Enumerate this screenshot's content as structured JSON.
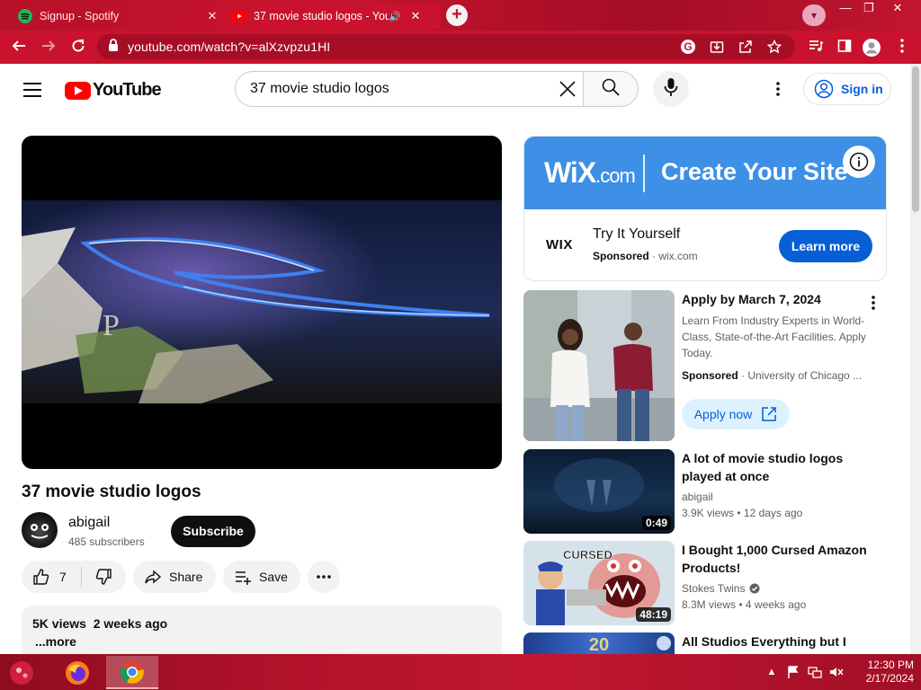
{
  "browser": {
    "tabs": [
      {
        "title": "Signup - Spotify",
        "active": false
      },
      {
        "title": "37 movie studio logos - YouTube",
        "active": true
      }
    ],
    "url": "youtube.com/watch?v=alXzvpzu1HI",
    "accent_color": "#c9122d"
  },
  "header": {
    "logo_text": "YouTube",
    "search_value": "37 movie studio logos",
    "signin_label": "Sign in"
  },
  "video": {
    "title": "37 movie studio logos",
    "channel": "abigail",
    "subscribers": "485 subscribers",
    "subscribe_label": "Subscribe",
    "likes": "7",
    "share_label": "Share",
    "save_label": "Save",
    "views_date": "5K views  2 weeks ago",
    "more_label": "...more"
  },
  "ad": {
    "banner_brand": "WiX",
    "banner_brand_suffix": ".com",
    "banner_cta": "Create Your Site >",
    "logo_text": "WIX",
    "headline": "Try It Yourself",
    "sponsored": "Sponsored",
    "domain": "wix.com",
    "button": "Learn more"
  },
  "sponsored_video": {
    "title": "Apply by March 7, 2024",
    "description": "Learn From Industry Experts in World-Class, State-of-the-Art Facilities. Apply Today.",
    "sponsored": "Sponsored",
    "advertiser": "University of Chicago ...",
    "button": "Apply now"
  },
  "recommendations": [
    {
      "title": "A lot of movie studio logos played at once",
      "channel": "abigail",
      "verified": false,
      "views": "3.9K views",
      "age": "12 days ago",
      "duration": "0:49"
    },
    {
      "title": "I Bought 1,000 Cursed Amazon Products!",
      "channel": "Stokes Twins",
      "verified": true,
      "views": "8.3M views",
      "age": "4 weeks ago",
      "duration": "48:19",
      "thumb_text": "CURSED"
    },
    {
      "title": "All Studios Everything but I",
      "channel": "",
      "views": "",
      "age": "",
      "duration": ""
    }
  ],
  "taskbar": {
    "time": "12:30 PM",
    "date": "2/17/2024"
  }
}
